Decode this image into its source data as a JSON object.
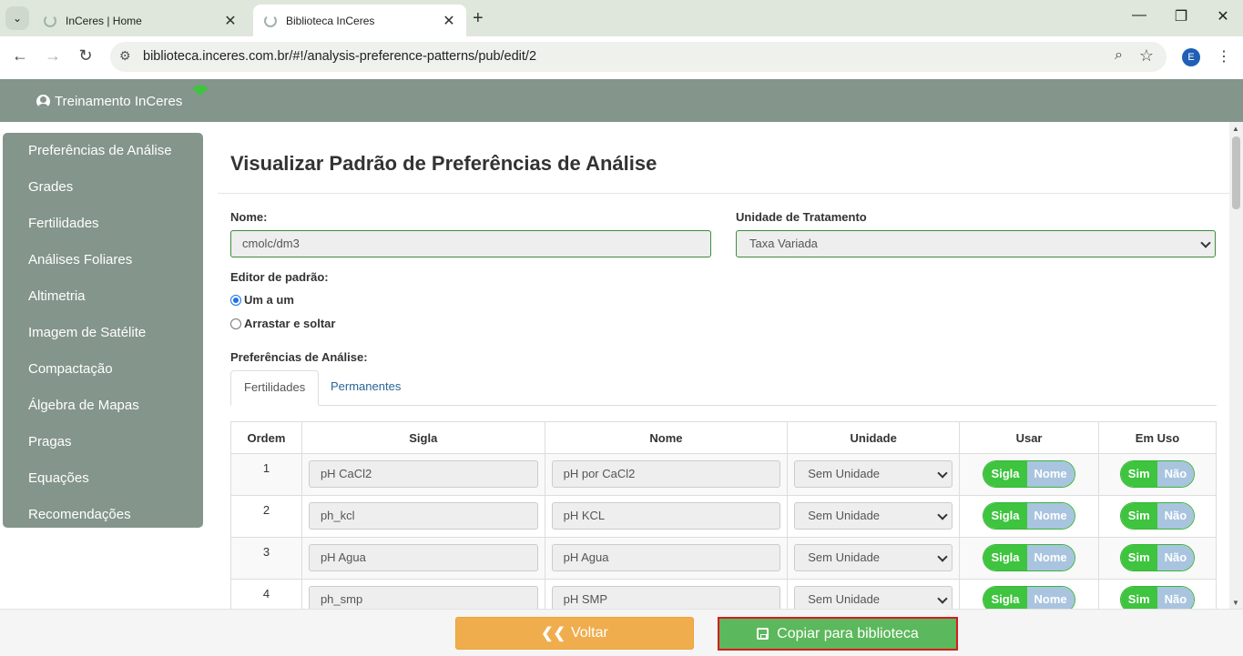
{
  "browser": {
    "tabs": [
      {
        "title": "InCeres | Home"
      },
      {
        "title": "Biblioteca InCeres"
      }
    ],
    "url": "biblioteca.inceres.com.br/#!/analysis-preference-patterns/pub/edit/2",
    "profile_initial": "E"
  },
  "header": {
    "user_name": "Treinamento InCeres"
  },
  "sidebar": {
    "items": [
      {
        "label": "Preferências de Análise"
      },
      {
        "label": "Grades"
      },
      {
        "label": "Fertilidades"
      },
      {
        "label": "Análises Foliares"
      },
      {
        "label": "Altimetria"
      },
      {
        "label": "Imagem de Satélite"
      },
      {
        "label": "Compactação"
      },
      {
        "label": "Álgebra de Mapas"
      },
      {
        "label": "Pragas"
      },
      {
        "label": "Equações"
      },
      {
        "label": "Recomendações"
      }
    ]
  },
  "main": {
    "title": "Visualizar Padrão de Preferências de Análise",
    "name_label": "Nome:",
    "name_value": "cmolc/dm3",
    "unit_label": "Unidade de Tratamento",
    "unit_value": "Taxa Variada",
    "editor_label": "Editor de padrão:",
    "editor_options": [
      "Um a um",
      "Arrastar e soltar"
    ],
    "prefs_label": "Preferências de Análise:",
    "tabs": [
      {
        "label": "Fertilidades"
      },
      {
        "label": "Permanentes"
      }
    ],
    "table": {
      "headers": [
        "Ordem",
        "Sigla",
        "Nome",
        "Unidade",
        "Usar",
        "Em Uso"
      ],
      "rows": [
        {
          "order": "1",
          "sigla": "pH CaCl2",
          "nome": "pH por CaCl2",
          "unidade": "Sem Unidade"
        },
        {
          "order": "2",
          "sigla": "ph_kcl",
          "nome": "pH KCL",
          "unidade": "Sem Unidade"
        },
        {
          "order": "3",
          "sigla": "pH Agua",
          "nome": "pH Agua",
          "unidade": "Sem Unidade"
        },
        {
          "order": "4",
          "sigla": "ph_smp",
          "nome": "pH SMP",
          "unidade": "Sem Unidade"
        }
      ],
      "usar_toggle": {
        "on": "Sigla",
        "off": "Nome"
      },
      "emuso_toggle": {
        "on": "Sim",
        "off": "Não"
      }
    }
  },
  "footer": {
    "back_label": "Voltar",
    "copy_label": "Copiar para biblioteca"
  },
  "colors": {
    "brand_gray_green": "#84958b",
    "toggle_on": "#3ec43e",
    "toggle_off": "#a9c4df",
    "back_button": "#f0ad4e",
    "copy_button": "#5cb85c",
    "highlight_border": "#d81b1b"
  }
}
